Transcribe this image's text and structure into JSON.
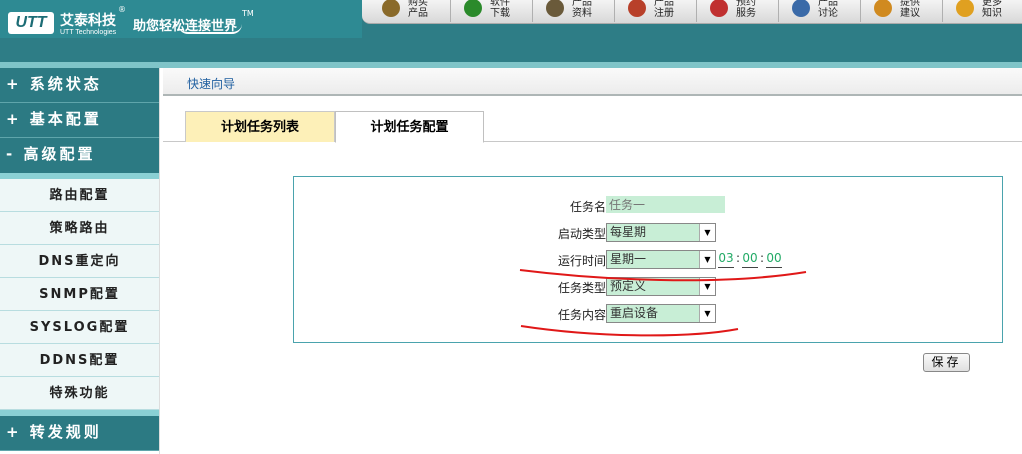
{
  "header": {
    "logo_text": "UTT",
    "brand_cn": "艾泰科技",
    "brand_en": "UTT Technologies",
    "slogan": "助您轻松连接世界",
    "trademark": "TM",
    "registered": "®",
    "toolbar": [
      {
        "icon": "search-icon",
        "label": "购买\n产品"
      },
      {
        "icon": "download-icon",
        "label": "软件\n下载"
      },
      {
        "icon": "book-icon",
        "label": "产品\n资料"
      },
      {
        "icon": "register-icon",
        "label": "产品\n注册"
      },
      {
        "icon": "support-icon",
        "label": "预约\n服务"
      },
      {
        "icon": "forum-icon",
        "label": "产品\n讨论"
      },
      {
        "icon": "feedback-icon",
        "label": "提供\n建议"
      },
      {
        "icon": "knowledge-icon",
        "label": "更多\n知识"
      }
    ],
    "colors": {
      "primary": "#2e7d86",
      "accent": "#7fc4c8"
    }
  },
  "sidebar": {
    "top_items": [
      {
        "label": "+ 系统状态"
      },
      {
        "label": "+ 基本配置"
      },
      {
        "label": "- 高级配置"
      },
      {
        "label": "+ 转发规则"
      }
    ],
    "sub_items": [
      {
        "label": "路由配置"
      },
      {
        "label": "策略路由"
      },
      {
        "label": "DNS重定向"
      },
      {
        "label": "SNMP配置"
      },
      {
        "label": "SYSLOG配置"
      },
      {
        "label": "DDNS配置"
      },
      {
        "label": "特殊功能"
      }
    ]
  },
  "main": {
    "breadcrumb": "快速向导",
    "tabs": [
      {
        "label": "计划任务列表",
        "active": false
      },
      {
        "label": "计划任务配置",
        "active": true
      }
    ],
    "form": {
      "task_name": {
        "label": "任务名",
        "placeholder": "任务一"
      },
      "start_type": {
        "label": "启动类型",
        "value": "每星期"
      },
      "run_time": {
        "label": "运行时间",
        "value": "星期一",
        "hour": "03",
        "minute": "00",
        "second": "00",
        "sep": ":"
      },
      "task_type": {
        "label": "任务类型",
        "value": "预定义"
      },
      "task_content": {
        "label": "任务内容",
        "value": "重启设备"
      }
    },
    "save_label": "保存"
  }
}
